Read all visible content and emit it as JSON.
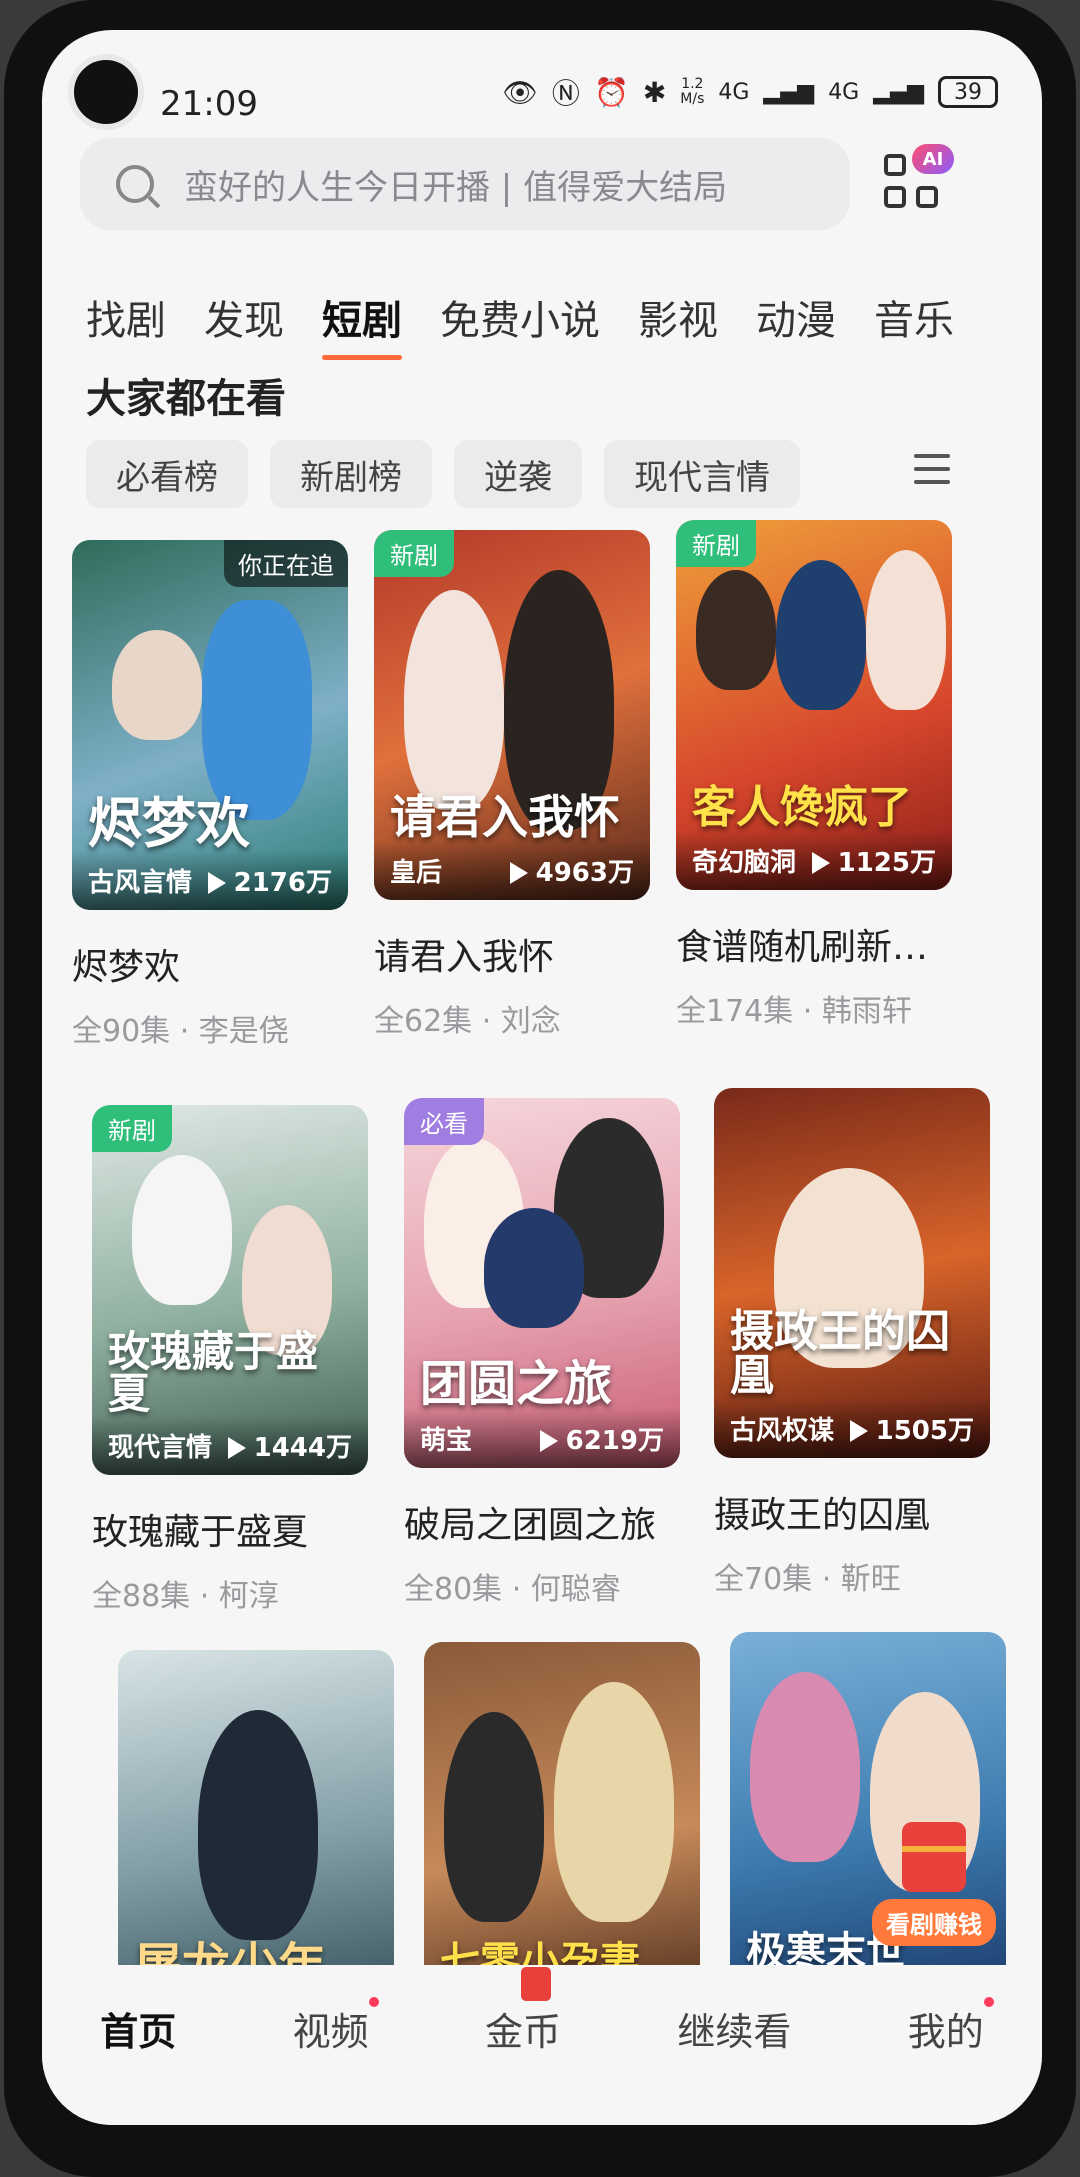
{
  "status_bar": {
    "time": "21:09",
    "net_speed": "1.2\nM/s",
    "sig1": "4G",
    "sig2": "4G",
    "battery": "39"
  },
  "search": {
    "placeholder": "蛮好的人生今日开播 | 值得爱大结局"
  },
  "ai_badge": "AI",
  "tabs": [
    {
      "label": "找剧"
    },
    {
      "label": "发现"
    },
    {
      "label": "短剧"
    },
    {
      "label": "免费小说"
    },
    {
      "label": "影视"
    },
    {
      "label": "动漫"
    },
    {
      "label": "音乐"
    }
  ],
  "active_tab": "短剧",
  "section_title": "大家都在看",
  "chips": [
    "必看榜",
    "新剧榜",
    "逆袭",
    "现代言情"
  ],
  "cards": [
    {
      "title": "烬梦欢",
      "poster_text": "烬梦欢",
      "genre": "古风言情",
      "views": "2176万",
      "episodes": "全90集",
      "actor": "李是侥",
      "badge": "",
      "watching": "你正在追"
    },
    {
      "title": "请君入我怀",
      "poster_text": "请君入我怀",
      "genre": "皇后",
      "views": "4963万",
      "episodes": "全62集",
      "actor": "刘念",
      "badge": "新剧",
      "watching": ""
    },
    {
      "title": "食谱随机刷新…",
      "poster_text": "客人馋疯了",
      "genre": "奇幻脑洞",
      "views": "1125万",
      "episodes": "全174集",
      "actor": "韩雨轩",
      "badge": "新剧",
      "watching": ""
    },
    {
      "title": "玫瑰藏于盛夏",
      "poster_text": "玫瑰藏于盛夏",
      "genre": "现代言情",
      "views": "1444万",
      "episodes": "全88集",
      "actor": "柯淳",
      "badge": "新剧",
      "watching": ""
    },
    {
      "title": "破局之团圆之旅",
      "poster_text": "团圆之旅",
      "genre": "萌宝",
      "views": "6219万",
      "episodes": "全80集",
      "actor": "何聪睿",
      "badge": "必看",
      "watching": ""
    },
    {
      "title": "摄政王的囚凰",
      "poster_text": "摄政王的囚凰",
      "genre": "古风权谋",
      "views": "1505万",
      "episodes": "全70集",
      "actor": "靳旺",
      "badge": "",
      "watching": ""
    },
    {
      "title": "",
      "poster_text": "屠龙少年",
      "genre": "",
      "views": "",
      "episodes": "",
      "actor": "",
      "badge": "",
      "watching": ""
    },
    {
      "title": "",
      "poster_text": "七零小孕妻",
      "genre": "",
      "views": "",
      "episodes": "",
      "actor": "",
      "badge": "",
      "watching": ""
    },
    {
      "title": "",
      "poster_text": "极寒末世",
      "genre": "",
      "views": "",
      "episodes": "",
      "actor": "",
      "badge": "",
      "watching": ""
    }
  ],
  "earn_label": "看剧赚钱",
  "bottom_nav": [
    {
      "label": "首页"
    },
    {
      "label": "视频"
    },
    {
      "label": "金币"
    },
    {
      "label": "继续看"
    },
    {
      "label": "我的"
    }
  ],
  "colors": {
    "accent": "#ff6a3d",
    "new_badge": "#2fbf7a",
    "must_badge": "#a07de0"
  }
}
